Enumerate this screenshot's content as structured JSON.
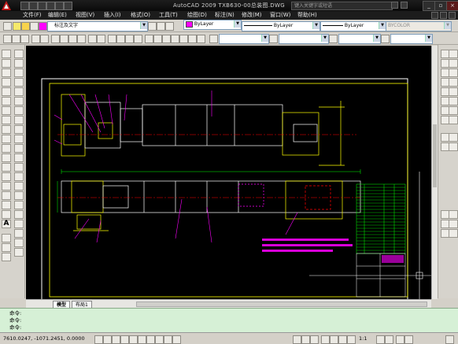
{
  "window": {
    "title": "AutoCAD 2009  TXB630-00总装图.DWG",
    "search_placeholder": "键入关键字或短语",
    "minimize": "_",
    "restore": "▫",
    "close": "×"
  },
  "menu": [
    "文件(F)",
    "编辑(E)",
    "视图(V)",
    "插入(I)",
    "格式(O)",
    "工具(T)",
    "绘图(D)",
    "标注(N)",
    "修改(M)",
    "窗口(W)",
    "帮助(H)"
  ],
  "toolbar1": {
    "layer_combo": "标注及文字",
    "color_combo": "ByLayer",
    "linetype_combo": "ByLayer",
    "lineweight_combo": "ByLayer",
    "plotstyle_combo": "BYCOLOR"
  },
  "drawing_tabs": [
    "模型",
    "布局1"
  ],
  "command": {
    "prompt": "命令:",
    "lines": [
      "命令:",
      "命令:",
      "命令:"
    ]
  },
  "status": {
    "coordinates": "7610.0247, -1071.2451, 0.0000",
    "scale": "1:1"
  },
  "colors": {
    "titlebar": "#111111",
    "canvas": "#000000",
    "drawing_white": "#ffffff",
    "drawing_magenta": "#ff00ff",
    "drawing_yellow": "#ffff00",
    "drawing_red": "#ff0000",
    "drawing_green": "#00ff00",
    "command_bg": "#d6f0d6"
  }
}
